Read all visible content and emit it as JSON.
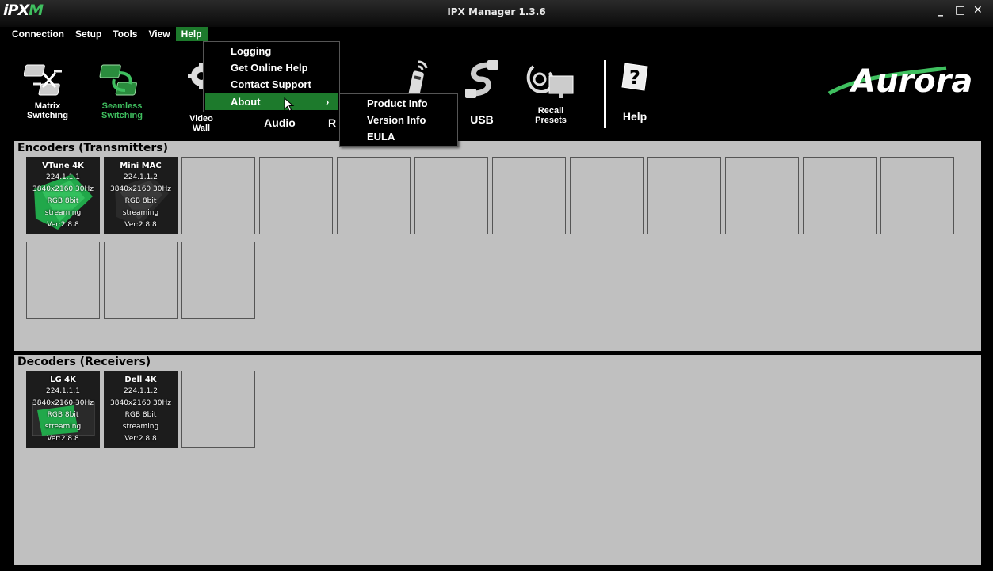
{
  "app": {
    "logo_prefix": "iPX",
    "logo_suffix": "M",
    "title": "IPX Manager 1.3.6"
  },
  "window_controls": {
    "minimize": "_",
    "maximize": "□",
    "close": "✕"
  },
  "menubar": [
    "Connection",
    "Setup",
    "Tools",
    "View",
    "Help"
  ],
  "toolbar": {
    "matrix_l1": "Matrix",
    "matrix_l2": "Switching",
    "seamless_l1": "Seamless",
    "seamless_l2": "Switching",
    "video_l1": "Video",
    "video_l2": "Wall",
    "audio": "Audio",
    "rs_partial": "R",
    "usb": "USB",
    "recall_l1": "Recall",
    "recall_l2": "Presets",
    "help": "Help"
  },
  "brand": {
    "name": "Aurora",
    "accent": "#3fbf5f",
    "highlight": "#1d7a2c"
  },
  "help_menu": [
    "Logging",
    "Get Online Help",
    "Contact Support",
    "About"
  ],
  "about_submenu": [
    "Product Info",
    "Version Info",
    "EULA"
  ],
  "submenu_arrow": "›",
  "encoders": {
    "title": "Encoders (Transmitters)",
    "devices": [
      {
        "name": "VTune 4K",
        "ip": "224.1.1.1",
        "res": "3840x2160 30Hz",
        "color": "RGB 8bit",
        "status": "streaming",
        "ver": "Ver:2.8.8"
      },
      {
        "name": "Mini MAC",
        "ip": "224.1.1.2",
        "res": "3840x2160 30Hz",
        "color": "RGB 8bit",
        "status": "streaming",
        "ver": "Ver:2.8.8"
      }
    ]
  },
  "decoders": {
    "title": "Decoders (Receivers)",
    "devices": [
      {
        "name": "LG 4K",
        "ip": "224.1.1.1",
        "res": "3840x2160 30Hz",
        "color": "RGB 8bit",
        "status": "streaming",
        "ver": "Ver:2.8.8"
      },
      {
        "name": "Dell 4K",
        "ip": "224.1.1.2",
        "res": "3840x2160 30Hz",
        "color": "RGB 8bit",
        "status": "streaming",
        "ver": "Ver:2.8.8"
      }
    ]
  }
}
